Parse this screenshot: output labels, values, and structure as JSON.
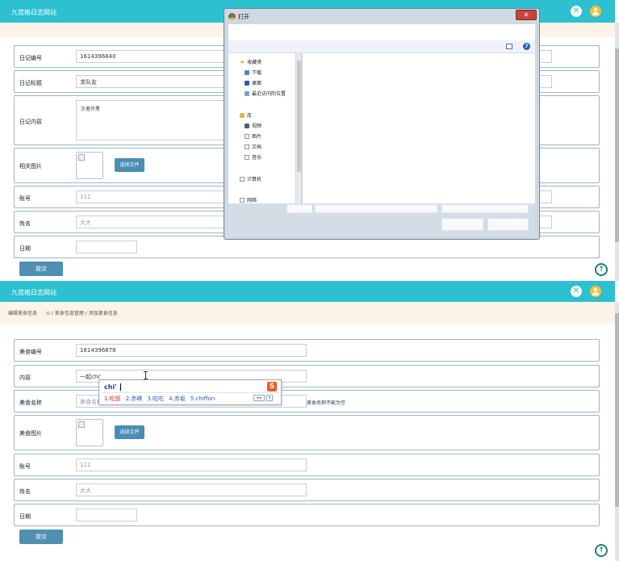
{
  "colors": {
    "header": "#2cc0d1",
    "button": "#4f8fb4",
    "peach": "#fdf3e7",
    "ime_accent": "#f25a24"
  },
  "panel1": {
    "app_title": "九宫格日志网站",
    "close_icon": "✕",
    "fields": {
      "id_label": "日记编号",
      "id_value": "1614396840",
      "title_label": "日记标题",
      "title_value": "求队友",
      "content_label": "日记内容",
      "content_value": "王者开黑",
      "image_label": "相关图片",
      "file_button": "选择文件",
      "account_label": "账号",
      "account_value": "111",
      "name_label": "姓名",
      "name_value": "大大",
      "date_label": "日期"
    },
    "submit": "提交",
    "scroll_top": "↑"
  },
  "dialog": {
    "title": "打开",
    "close": "✕",
    "help": "?",
    "nav": {
      "favorites": "收藏夹",
      "downloads": "下载",
      "desktop": "桌面",
      "recent": "最近访问的位置",
      "libraries": "库",
      "videos": "视频",
      "pictures": "图片",
      "documents": "文档",
      "music": "音乐",
      "computer": "计算机",
      "network": "网络"
    }
  },
  "panel2": {
    "app_title": "九宫格日志网站",
    "close_icon": "✕",
    "breadcrumb": {
      "current": "编辑美食信息",
      "path": "⊙ / 美食信息管理 / 添加美食信息"
    },
    "fields": {
      "id_label": "美食编号",
      "id_value": "1614396878",
      "content_label": "内容",
      "content_value": "一起chi'",
      "food_name_label": "美食名称",
      "food_name_value": "美食名称",
      "error": "美食名称不能为空",
      "image_label": "美食图片",
      "file_button": "选择文件",
      "account_label": "账号",
      "account_value": "111",
      "name_label": "姓名",
      "name_value": "大大",
      "date_label": "日期"
    },
    "submit": "提交",
    "scroll_top": "↑"
  },
  "ime": {
    "composition": "chi'",
    "logo": "S",
    "candidates": [
      "1.吃饭",
      "2.赤峰",
      "3.吃吃",
      "4.赤坂",
      "5.chiffon"
    ],
    "arrows": "◂ ▸",
    "more": "▾"
  }
}
